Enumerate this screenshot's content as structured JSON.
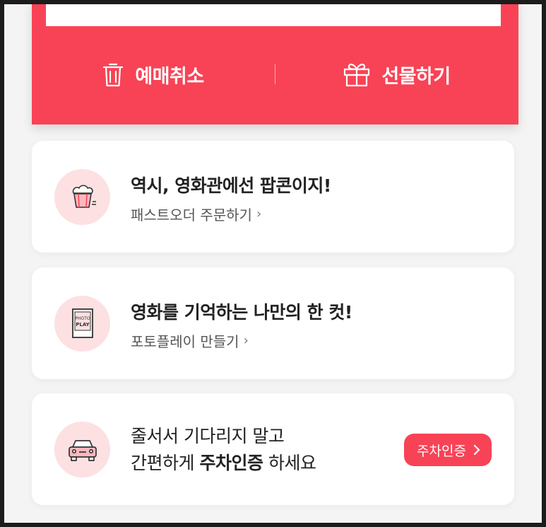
{
  "ticket": {
    "actions": [
      {
        "label": "예매취소",
        "icon": "trash-icon"
      },
      {
        "label": "선물하기",
        "icon": "gift-icon"
      }
    ]
  },
  "cards": {
    "popcorn": {
      "title": "역시, 영화관에선 팝콘이지!",
      "link": "패스트오더 주문하기",
      "icon": "popcorn-icon"
    },
    "photo": {
      "title": "영화를 기억하는 나만의 한 컷!",
      "link": "포토플레이 만들기",
      "icon": "photo-play-icon",
      "icon_text_top": "PHOTO",
      "icon_text_bottom": "PLAY"
    },
    "parking": {
      "line1": "줄서서 기다리지 말고",
      "line2_pre": "간편하게",
      "line2_bold": "주차인증",
      "line2_post": "하세요",
      "button": "주차인증",
      "icon": "car-icon"
    }
  },
  "chevron": "›",
  "colors": {
    "accent": "#f84356",
    "icon_bg": "#fde0e2"
  }
}
